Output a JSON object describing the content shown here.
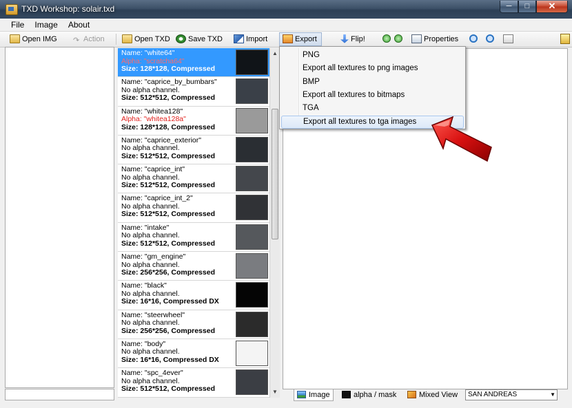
{
  "window": {
    "title": "TXD Workshop: solair.txd"
  },
  "menu": [
    "File",
    "Image",
    "About"
  ],
  "toolbar": {
    "open_img": "Open IMG",
    "action": "Action",
    "open_txd": "Open TXD",
    "save_txd": "Save TXD",
    "import": "Import",
    "export": "Export",
    "flip": "Flip!",
    "properties": "Properties"
  },
  "textures": [
    {
      "name": "Name: \"white64\"",
      "alpha": "Alpha: \"scratcha64\"",
      "size": "Size: 128*128, Compressed",
      "selected": true,
      "thumb": "#101418"
    },
    {
      "name": "Name: \"caprice_by_bumbars\"",
      "alpha": "No alpha channel.",
      "size": "Size: 512*512, Compressed",
      "thumb": "#3a4048"
    },
    {
      "name": "Name: \"whitea128\"",
      "alpha": "Alpha: \"whitea128a\"",
      "size": "Size: 128*128, Compressed",
      "thumb": "#9a9a9a"
    },
    {
      "name": "Name: \"caprice_exterior\"",
      "alpha": "No alpha channel.",
      "size": "Size: 512*512, Compressed",
      "thumb": "#2a2e33"
    },
    {
      "name": "Name: \"caprice_int\"",
      "alpha": "No alpha channel.",
      "size": "Size: 512*512, Compressed",
      "thumb": "#44474c"
    },
    {
      "name": "Name: \"caprice_int_2\"",
      "alpha": "No alpha channel.",
      "size": "Size: 512*512, Compressed",
      "thumb": "#303236"
    },
    {
      "name": "Name: \"intake\"",
      "alpha": "No alpha channel.",
      "size": "Size: 512*512, Compressed",
      "thumb": "#55585c"
    },
    {
      "name": "Name: \"gm_engine\"",
      "alpha": "No alpha channel.",
      "size": "Size: 256*256, Compressed",
      "thumb": "#7a7c80"
    },
    {
      "name": "Name: \"black\"",
      "alpha": "No alpha channel.",
      "size": "Size: 16*16, Compressed DX",
      "thumb": "#050505"
    },
    {
      "name": "Name: \"steerwheel\"",
      "alpha": "No alpha channel.",
      "size": "Size: 256*256, Compressed",
      "thumb": "#2b2b2b"
    },
    {
      "name": "Name: \"body\"",
      "alpha": "No alpha channel.",
      "size": "Size: 16*16, Compressed DX",
      "thumb": "#f4f4f4"
    },
    {
      "name": "Name: \"spc_4ever\"",
      "alpha": "No alpha channel.",
      "size": "Size: 512*512, Compressed",
      "thumb": "#3b3e44"
    }
  ],
  "export_menu": [
    {
      "label": "PNG",
      "highlighted": false
    },
    {
      "label": "Export all textures to png images",
      "highlighted": false
    },
    {
      "label": "BMP",
      "highlighted": false
    },
    {
      "label": "Export all textures to bitmaps",
      "highlighted": false
    },
    {
      "label": "TGA",
      "highlighted": false
    },
    {
      "label": "Export all textures to tga images",
      "highlighted": true
    }
  ],
  "view_tabs": {
    "image": "Image",
    "alpha": "alpha / mask",
    "mixed": "Mixed View"
  },
  "game_select": {
    "value": "SAN ANDREAS"
  },
  "colors": {
    "selection": "#3399ff",
    "alpha_text": "#e0201c",
    "arrow": "#d81010"
  }
}
